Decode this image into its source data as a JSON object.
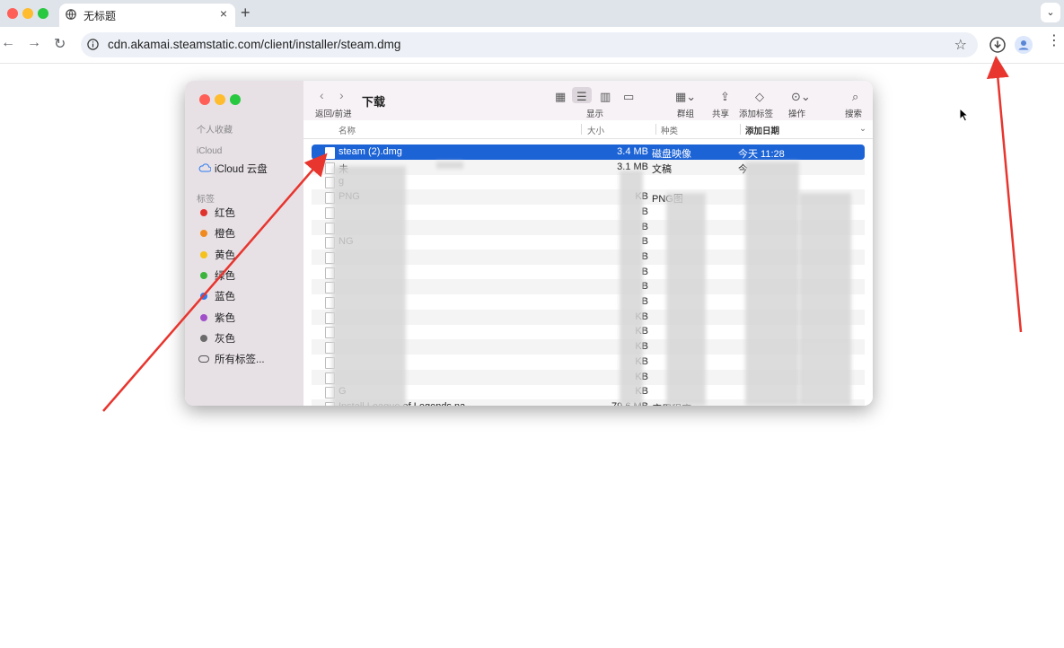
{
  "browser": {
    "tab_title": "无标题",
    "new_tab_symbol": "+",
    "close_symbol": "×",
    "url": "cdn.akamai.steamstatic.com/client/installer/steam.dmg",
    "back_symbol": "←",
    "forward_symbol": "→",
    "reload_symbol": "↻",
    "bookmark_symbol": "☆",
    "menu_symbol": "⋮",
    "tab_menu_symbol": "⌄"
  },
  "finder": {
    "title": "下载",
    "nav_label": "返回/前进",
    "toolbar": {
      "view_label": "显示",
      "group_label": "群组",
      "share_label": "共享",
      "tag_label": "添加标签",
      "action_label": "操作",
      "search_label": "搜索"
    },
    "sidebar": {
      "favorites_header": "个人收藏",
      "icloud_header": "iCloud",
      "icloud_drive": "iCloud 云盘",
      "tags_header": "标签",
      "tags": [
        {
          "label": "红色",
          "color": "#e0322d"
        },
        {
          "label": "橙色",
          "color": "#f08a1e"
        },
        {
          "label": "黄色",
          "color": "#f5c21c"
        },
        {
          "label": "绿色",
          "color": "#3cb43c"
        },
        {
          "label": "蓝色",
          "color": "#2f7bf0"
        },
        {
          "label": "紫色",
          "color": "#a050c8"
        },
        {
          "label": "灰色",
          "color": "#8e8e8e"
        }
      ],
      "all_tags": "所有标签..."
    },
    "columns": {
      "name": "名称",
      "size": "大小",
      "kind": "种类",
      "date": "添加日期"
    },
    "rows": [
      {
        "name": "steam (2).dmg",
        "size": "3.4 MB",
        "kind": "磁盘映像",
        "date": "今天 11:28"
      },
      {
        "name": "未",
        "size": "3.1 MB",
        "kind": "文稿",
        "date": "今"
      },
      {
        "name": "g",
        "size": "",
        "kind": "",
        "date": ""
      },
      {
        "name": "PNG",
        "size": "KB",
        "kind": "PNG图",
        "date": ""
      },
      {
        "name": "",
        "size": "B",
        "kind": "",
        "date": ""
      },
      {
        "name": "",
        "size": "B",
        "kind": "",
        "date": ""
      },
      {
        "name": "NG",
        "size": "B",
        "kind": "",
        "date": ""
      },
      {
        "name": "",
        "size": "B",
        "kind": "",
        "date": ""
      },
      {
        "name": "",
        "size": "B",
        "kind": "",
        "date": ""
      },
      {
        "name": "",
        "size": "B",
        "kind": "",
        "date": ""
      },
      {
        "name": "",
        "size": "B",
        "kind": "",
        "date": ""
      },
      {
        "name": "",
        "size": "KB",
        "kind": "",
        "date": ""
      },
      {
        "name": "",
        "size": "KB",
        "kind": "",
        "date": ""
      },
      {
        "name": "",
        "size": "KB",
        "kind": "",
        "date": ""
      },
      {
        "name": "",
        "size": "KB",
        "kind": "",
        "date": ""
      },
      {
        "name": "",
        "size": "KB",
        "kind": "",
        "date": ""
      },
      {
        "name": "G",
        "size": "KB",
        "kind": "",
        "date": ""
      },
      {
        "name": "Install League of Legends na",
        "size": "79.6 MB",
        "kind": "应用程序",
        "date": ""
      }
    ]
  },
  "colors": {
    "selection": "#1c63d6",
    "annotation_arrow": "#e8352e"
  }
}
